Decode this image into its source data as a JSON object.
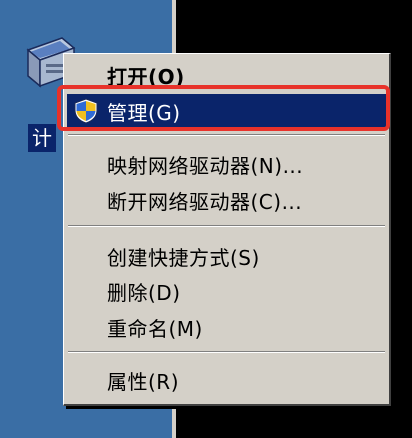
{
  "desktop": {
    "icon_name": "computer-icon",
    "label_partial": "计"
  },
  "context_menu": {
    "items": [
      {
        "label": "打开(O)",
        "bold": true
      },
      {
        "label": "管理(G)",
        "icon": "uac-shield-icon",
        "selected": true
      },
      {
        "label": "映射网络驱动器(N)..."
      },
      {
        "label": "断开网络驱动器(C)..."
      },
      {
        "label": "创建快捷方式(S)"
      },
      {
        "label": "删除(D)"
      },
      {
        "label": "重命名(M)"
      },
      {
        "label": "属性(R)"
      }
    ]
  },
  "colors": {
    "desktop": "#3a6ea5",
    "menu_bg": "#d4d0c8",
    "selection": "#0a246a",
    "highlight_border": "#e8322a"
  }
}
